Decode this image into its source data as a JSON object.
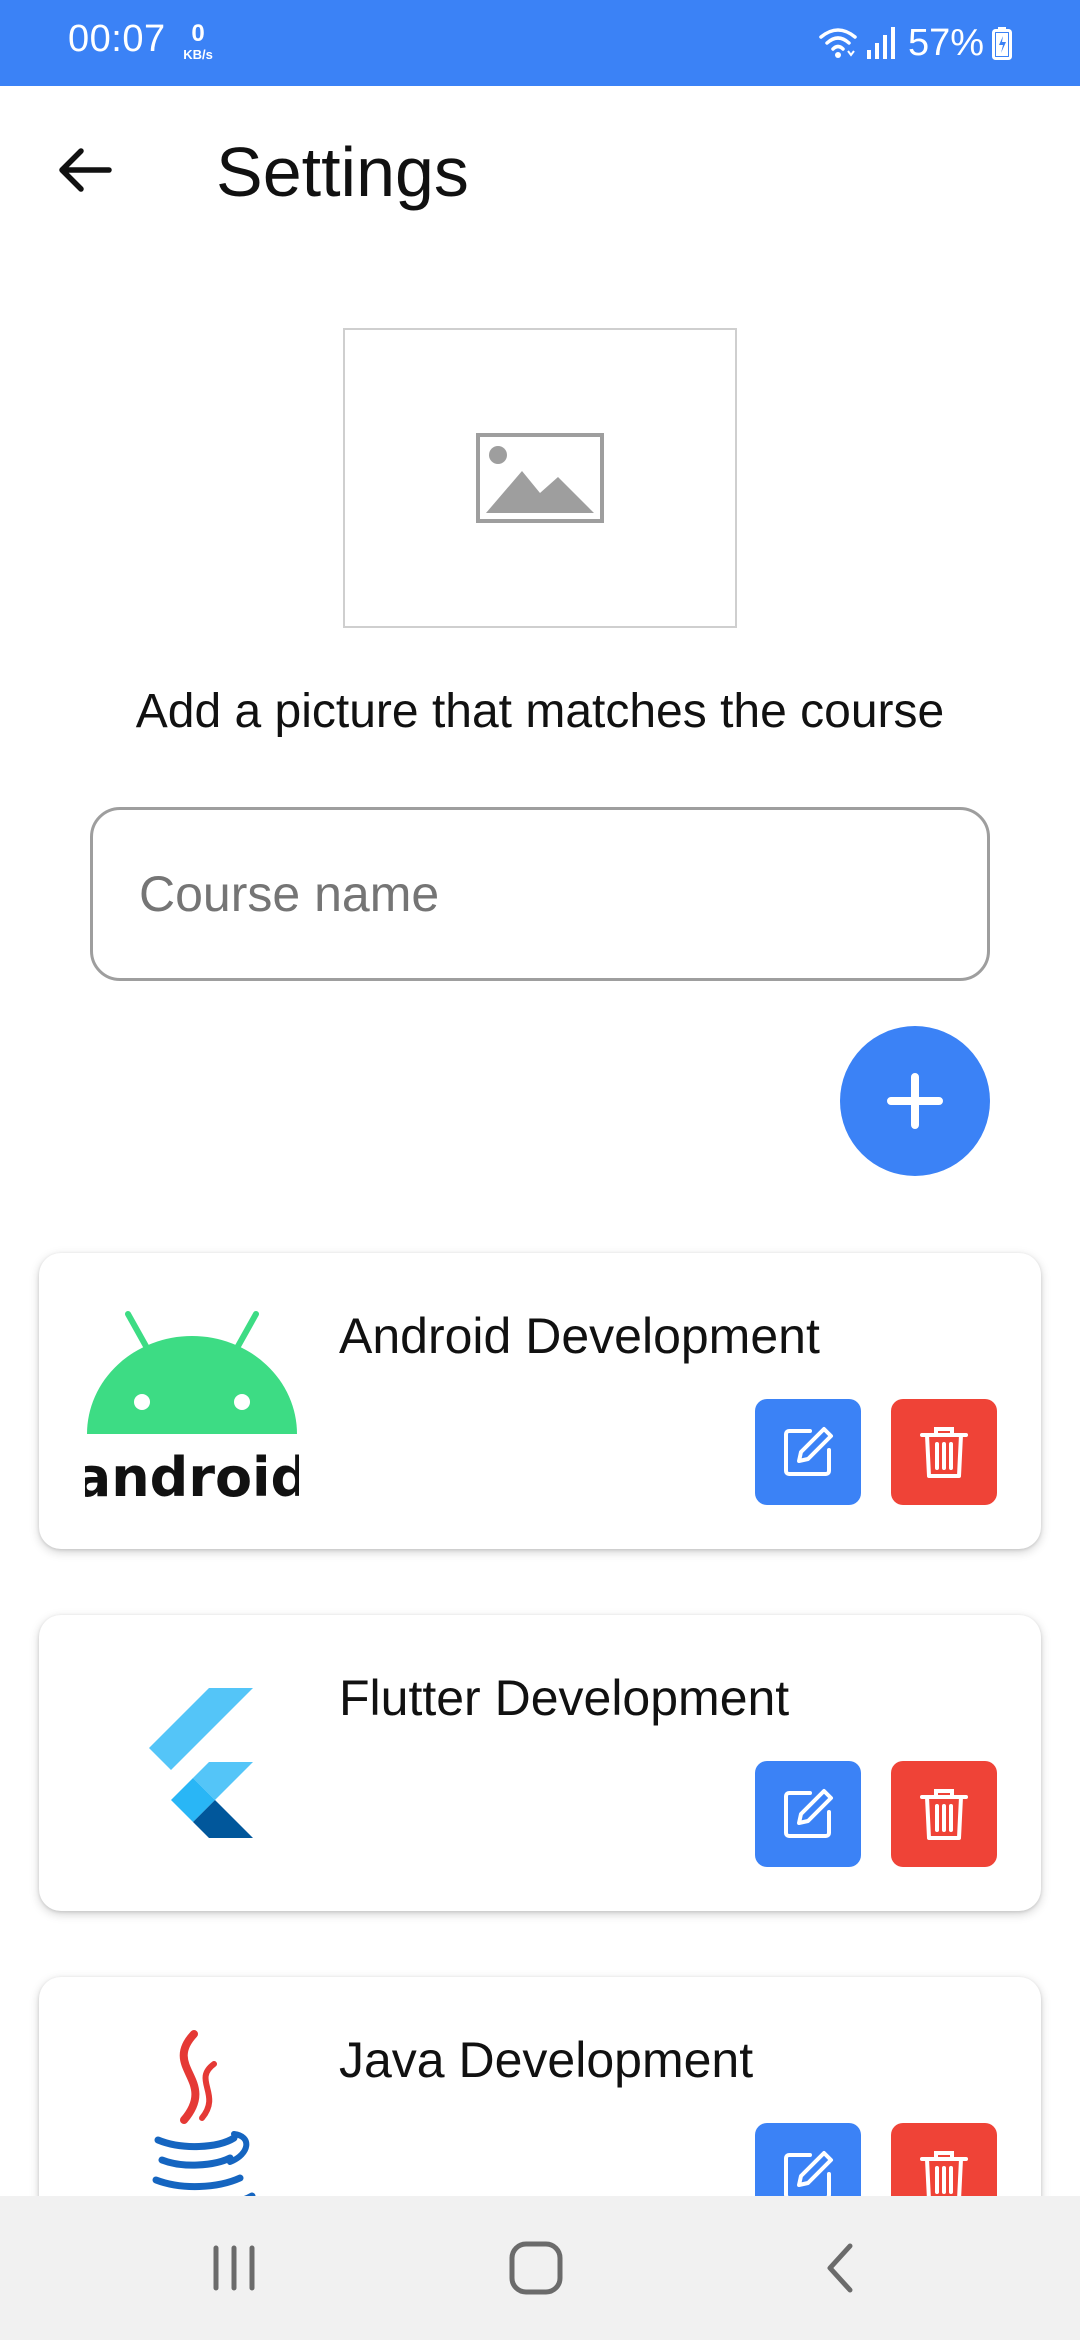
{
  "status_bar": {
    "time": "00:07",
    "net_speed_value": "0",
    "net_speed_unit": "KB/s",
    "battery_percent": "57%",
    "bar_color": "#3b82f6"
  },
  "header": {
    "title": "Settings",
    "back_icon": "arrow-left-icon"
  },
  "image_picker": {
    "icon": "image-placeholder-icon",
    "caption": "Add a picture that matches the course"
  },
  "course_input": {
    "placeholder": "Course name",
    "value": ""
  },
  "add_button": {
    "icon": "plus-icon",
    "color": "#3b82f6"
  },
  "courses": [
    {
      "name": "Android Development",
      "logo": "android-logo",
      "logo_text": "android",
      "edit_icon": "edit-icon",
      "delete_icon": "trash-icon"
    },
    {
      "name": "Flutter Development",
      "logo": "flutter-logo",
      "edit_icon": "edit-icon",
      "delete_icon": "trash-icon"
    },
    {
      "name": "Java Development",
      "logo": "java-logo",
      "edit_icon": "edit-icon",
      "delete_icon": "trash-icon"
    }
  ],
  "colors": {
    "accent": "#3b82f6",
    "delete": "#ef4337",
    "android_green": "#3ddc84"
  },
  "nav_bar": {
    "recents_icon": "recents-icon",
    "home_icon": "home-icon",
    "back_icon": "chevron-left-icon"
  }
}
